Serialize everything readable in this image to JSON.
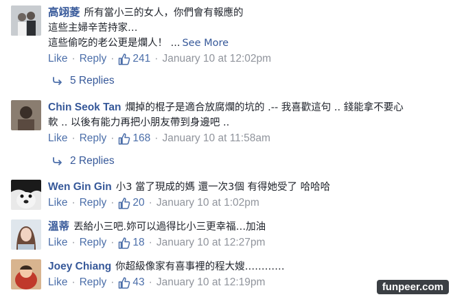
{
  "comments": [
    {
      "author": "高翊菱",
      "lines": [
        "所有當小三的女人，你們會有報應的",
        "這些主婦辛苦持家…",
        "這些偷吃的老公更是爛人！ ..."
      ],
      "see_more": "See More",
      "like": "Like",
      "reply": "Reply",
      "likes": "241",
      "time": "January 10 at 12:02pm",
      "replies": "5 Replies"
    },
    {
      "author": "Chin Seok Tan",
      "lines": [
        "爛掉的棍子是適合放腐爛的坑的 .-- 我喜歡這句 .. 錢能拿不要心",
        "軟 .. 以後有能力再把小朋友帶到身邊吧 .."
      ],
      "like": "Like",
      "reply": "Reply",
      "likes": "168",
      "time": "January 10 at 11:58am",
      "replies": "2 Replies"
    },
    {
      "author": "Wen Gin Gin",
      "lines": [
        "小3 當了現成的媽 還一次3個 有得她受了 哈哈哈"
      ],
      "like": "Like",
      "reply": "Reply",
      "likes": "20",
      "time": "January 10 at 1:02pm"
    },
    {
      "author": "溫蒂",
      "lines": [
        "丟給小三吧.妳可以過得比小三更幸福…加油"
      ],
      "like": "Like",
      "reply": "Reply",
      "likes": "18",
      "time": "January 10 at 12:27pm"
    },
    {
      "author": "Joey Chiang",
      "lines": [
        "你超級像家有喜事裡的程大嫂…………"
      ],
      "like": "Like",
      "reply": "Reply",
      "likes": "43",
      "time": "January 10 at 12:19pm"
    }
  ],
  "watermark": "funpeer.com",
  "colors": {
    "link": "#365899",
    "action": "#4b6ea9",
    "meta": "#90949c",
    "text": "#1d2129"
  }
}
